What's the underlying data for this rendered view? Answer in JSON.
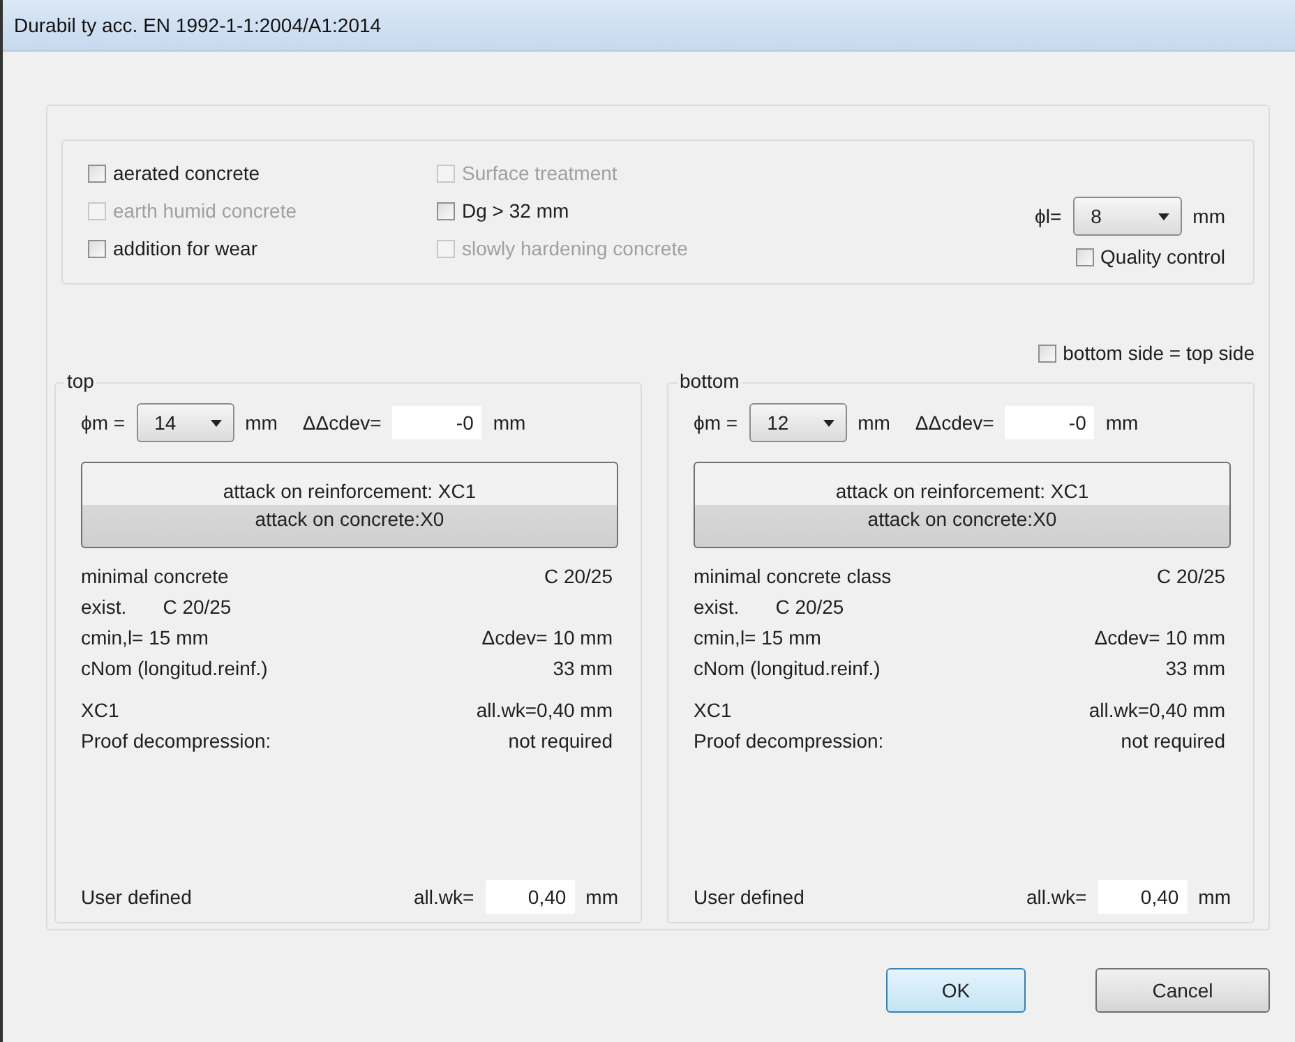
{
  "window": {
    "title": "Durabil ty acc. EN 1992-1-1:2004/A1:2014"
  },
  "options": {
    "columns": [
      [
        {
          "label": "aerated concrete",
          "checked": false,
          "disabled": false
        },
        {
          "label": "earth humid concrete",
          "checked": false,
          "disabled": true
        },
        {
          "label": "addition for wear",
          "checked": false,
          "disabled": false
        }
      ],
      [
        {
          "label": "Surface treatment",
          "checked": false,
          "disabled": true
        },
        {
          "label": "Dg > 32 mm",
          "checked": false,
          "disabled": false
        },
        {
          "label": "slowly hardening concrete",
          "checked": false,
          "disabled": true
        }
      ]
    ],
    "bar_diameter": {
      "label": "ϕl=",
      "value": "8",
      "unit": "mm"
    },
    "quality_control": {
      "label": "Quality control",
      "checked": false,
      "disabled": false
    }
  },
  "same_sides": {
    "label": "bottom side = top side",
    "checked": false,
    "disabled": false
  },
  "panels": [
    {
      "title": "top",
      "diameter_label": "ϕm =",
      "diameter": "14",
      "diameter_unit": "mm",
      "dev_label": "ΔΔcdev=",
      "dev_value": "-0",
      "dev_unit": "mm",
      "attack": [
        "attack on reinforcement: XC1",
        "attack on concrete:X0"
      ],
      "sections": [
        [
          {
            "kind": "split",
            "left": "minimal concrete",
            "right": "C 20/25"
          },
          {
            "kind": "inline",
            "left": "exist.",
            "right": "C 20/25"
          },
          {
            "kind": "split",
            "left": "cmin,l=  15 mm",
            "right": "Δcdev=  10 mm"
          },
          {
            "kind": "split",
            "left": "cNom (longitud.reinf.)",
            "right": "33 mm"
          }
        ],
        [
          {
            "kind": "split",
            "left": "XC1",
            "right": "all.wk=0,40 mm"
          },
          {
            "kind": "split",
            "left": "Proof decompression:",
            "right": "not required"
          }
        ]
      ],
      "user_label": "User defined",
      "wk_label": "all.wk=",
      "wk_value": "0,40",
      "wk_unit": "mm"
    },
    {
      "title": "bottom",
      "diameter_label": "ϕm =",
      "diameter": "12",
      "diameter_unit": "mm",
      "dev_label": "ΔΔcdev=",
      "dev_value": "-0",
      "dev_unit": "mm",
      "attack": [
        "attack on reinforcement: XC1",
        "attack on concrete:X0"
      ],
      "sections": [
        [
          {
            "kind": "split",
            "left": "minimal concrete class",
            "right": "C 20/25"
          },
          {
            "kind": "inline",
            "left": "exist.",
            "right": "C 20/25"
          },
          {
            "kind": "split",
            "left": "cmin,l=  15 mm",
            "right": "Δcdev=  10 mm"
          },
          {
            "kind": "split",
            "left": "cNom (longitud.reinf.)",
            "right": "33 mm"
          }
        ],
        [
          {
            "kind": "split",
            "left": "XC1",
            "right": "all.wk=0,40 mm"
          },
          {
            "kind": "split",
            "left": "Proof decompression:",
            "right": "not required"
          }
        ]
      ],
      "user_label": "User defined",
      "wk_label": "all.wk=",
      "wk_value": "0,40",
      "wk_unit": "mm"
    }
  ],
  "buttons": [
    {
      "label": "OK",
      "default": true
    },
    {
      "label": "Cancel",
      "default": false
    }
  ]
}
